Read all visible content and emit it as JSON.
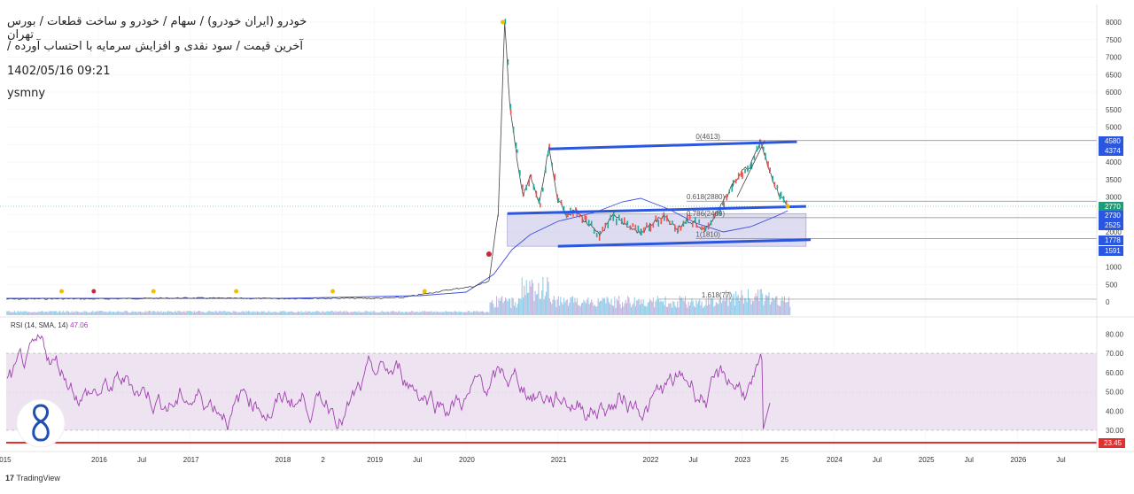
{
  "header": {
    "line1": "خودرو (ایران خودرو) / سهام / خودرو و ساخت قطعات / بورس تهران",
    "line2": "آخرین قیمت / سود نقدی و افزایش سرمایه با احتساب آورده /",
    "datetime": "1402/05/16 09:21",
    "author": "ysmny"
  },
  "footer": {
    "brand": "TradingView"
  },
  "chart_data": [
    {
      "type": "line",
      "name": "price",
      "y_ticks": [
        0,
        500,
        1000,
        1500,
        2000,
        2500,
        3000,
        3500,
        4000,
        4500,
        5000,
        5500,
        6000,
        6500,
        7000,
        7500,
        8000
      ],
      "x_ticks": [
        "015",
        "2016",
        "Jul",
        "2017",
        "2018",
        "2",
        "2019",
        "Jul",
        "2020",
        "2021",
        "2022",
        "Jul",
        "2023",
        "25",
        "2024",
        "Jul",
        "2025",
        "Jul",
        "2026",
        "Jul"
      ],
      "x": [
        2015.0,
        2015.5,
        2016.0,
        2016.5,
        2017.0,
        2017.5,
        2018.0,
        2018.5,
        2019.0,
        2019.3,
        2019.6,
        2019.9,
        2020.1,
        2020.25,
        2020.35,
        2020.42,
        2020.48,
        2020.55,
        2020.62,
        2020.7,
        2020.8,
        2020.9,
        2021.0,
        2021.1,
        2021.2,
        2021.3,
        2021.45,
        2021.6,
        2021.75,
        2021.9,
        2022.0,
        2022.15,
        2022.3,
        2022.4,
        2022.5,
        2022.6,
        2022.7,
        2022.8,
        2022.9,
        2023.0,
        2023.1,
        2023.2,
        2023.25,
        2023.3,
        2023.35,
        2023.42,
        2023.5
      ],
      "y": [
        80,
        90,
        85,
        100,
        110,
        100,
        95,
        105,
        100,
        120,
        250,
        380,
        450,
        600,
        2500,
        8000,
        5500,
        4200,
        3000,
        3600,
        2800,
        4374,
        2900,
        2500,
        2600,
        2300,
        1900,
        2450,
        2200,
        1950,
        2200,
        2450,
        2050,
        2350,
        2250,
        2050,
        2400,
        2850,
        3350,
        3700,
        3900,
        4580,
        4200,
        3700,
        3400,
        3000,
        2700
      ],
      "ylim": [
        0,
        8200
      ],
      "last_value": 2770,
      "price_tags": [
        4580,
        4374,
        2770,
        2730,
        2525,
        1778,
        1591
      ],
      "fib_labels": [
        "0(4613)",
        "0.618(2880)",
        "0.786(2409)",
        "1(1810)",
        "1.618(77)"
      ],
      "fib_values": [
        4613,
        2880,
        2409,
        1810,
        77
      ],
      "channel_top": [
        [
          2020.9,
          4374
        ],
        [
          2023.6,
          4580
        ]
      ],
      "channel_mid": [
        [
          2020.45,
          2525
        ],
        [
          2023.7,
          2730
        ]
      ],
      "channel_bottom": [
        [
          2021.0,
          1591
        ],
        [
          2023.75,
          1778
        ]
      ],
      "range_box": [
        [
          2020.45,
          2525
        ],
        [
          2023.7,
          1591
        ]
      ]
    },
    {
      "type": "line",
      "name": "RSI (14, SMA, 14)",
      "label": "RSI (14, SMA, 14)",
      "value_label": "47.06",
      "y_ticks": [
        "30.00",
        "40.00",
        "50.00",
        "60.00",
        "70.00",
        "80.00"
      ],
      "ylim": [
        20,
        90
      ],
      "band": [
        30,
        70
      ],
      "last_value": 47.06,
      "marker": "23.45"
    }
  ]
}
